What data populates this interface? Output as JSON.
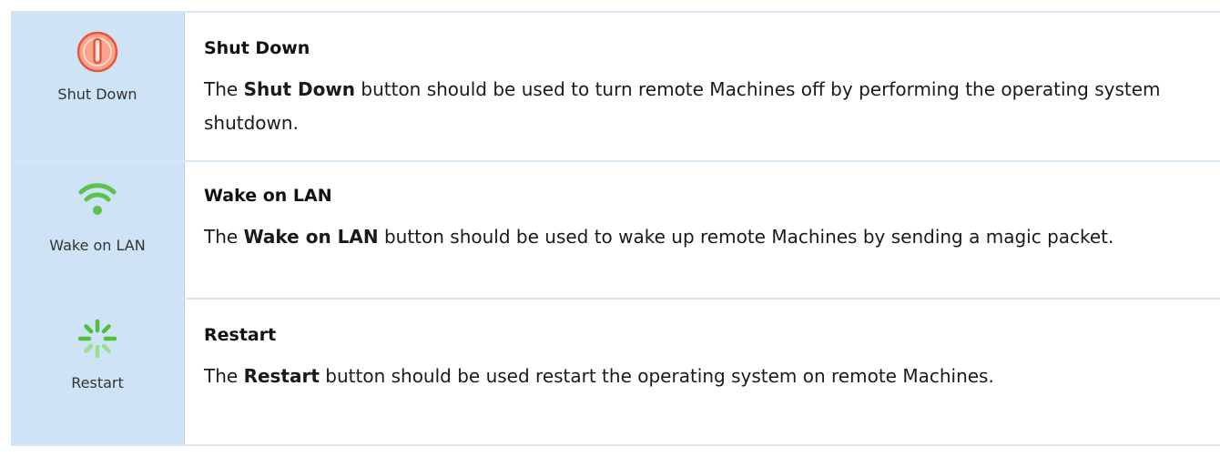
{
  "rows": [
    {
      "icon": "power-icon",
      "caption": "Shut Down",
      "title": "Shut Down",
      "desc_prefix": "The ",
      "desc_bold": "Shut Down",
      "desc_suffix": " button should be used to turn remote Machines off by performing the operating system shutdown."
    },
    {
      "icon": "wifi-icon",
      "caption": "Wake on LAN",
      "title": "Wake on LAN",
      "desc_prefix": "The ",
      "desc_bold": "Wake on LAN",
      "desc_suffix": " button should be used to wake up remote Machines by sending a magic packet."
    },
    {
      "icon": "restart-spinner-icon",
      "caption": "Restart",
      "title": "Restart",
      "desc_prefix": "The ",
      "desc_bold": "Restart",
      "desc_suffix": " button should be used restart the operating system on remote Machines."
    }
  ],
  "colors": {
    "icon_column_bg": "#cfe3f6",
    "row_border": "#d8e5f2",
    "power_icon": "#f26d4f",
    "wifi_icon": "#5cc24a",
    "restart_icon": "#4fbf3c"
  }
}
